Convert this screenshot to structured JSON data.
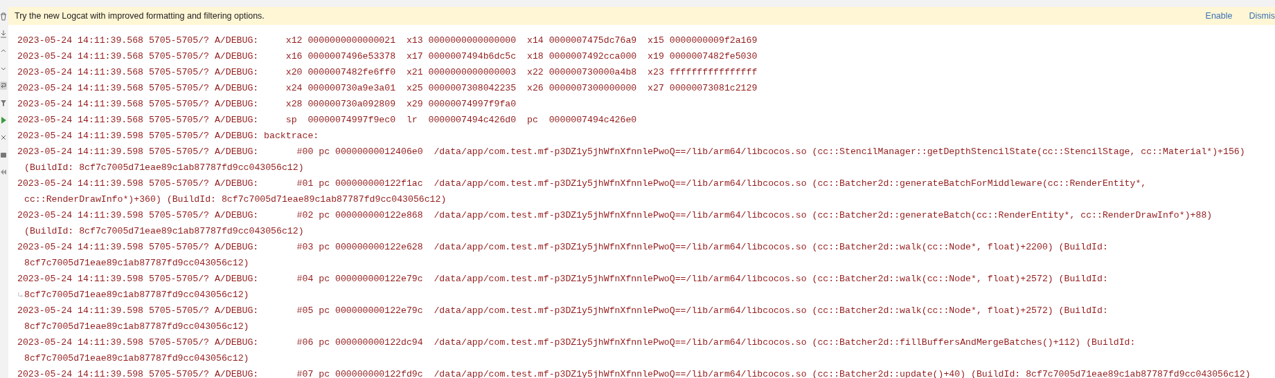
{
  "banner": {
    "message": "Try the new Logcat with improved formatting and filtering options.",
    "actions": [
      "Enable",
      "Dismis"
    ]
  },
  "toolbar": [
    {
      "kind": "trash",
      "selected": false
    },
    {
      "kind": "down",
      "selected": false
    },
    {
      "kind": "up",
      "selected": false
    },
    {
      "kind": "check",
      "selected": false
    },
    {
      "kind": "wrap",
      "selected": true
    },
    {
      "kind": "filter",
      "selected": false
    },
    {
      "kind": "play",
      "selected": false
    },
    {
      "kind": "close",
      "selected": false
    },
    {
      "kind": "camera",
      "selected": false
    },
    {
      "kind": "back",
      "selected": false
    }
  ],
  "log": [
    {
      "lines": [
        "2023-05-24 14:11:39.568 5705-5705/? A/DEBUG:     x12 0000000000000021  x13 0000000000000000  x14 0000007475dc76a9  x15 0000000009f2a169"
      ]
    },
    {
      "lines": [
        "2023-05-24 14:11:39.568 5705-5705/? A/DEBUG:     x16 0000007496e53378  x17 0000007494b6dc5c  x18 0000007492cca000  x19 0000007482fe5030"
      ]
    },
    {
      "lines": [
        "2023-05-24 14:11:39.568 5705-5705/? A/DEBUG:     x20 0000007482fe6ff0  x21 0000000000000003  x22 000000730000a4b8  x23 ffffffffffffffff"
      ]
    },
    {
      "lines": [
        "2023-05-24 14:11:39.568 5705-5705/? A/DEBUG:     x24 000000730a9e3a01  x25 0000007308042235  x26 0000007300000000  x27 00000073081c2129"
      ]
    },
    {
      "lines": [
        "2023-05-24 14:11:39.568 5705-5705/? A/DEBUG:     x28 000000730a092809  x29 00000074997f9fa0"
      ]
    },
    {
      "lines": [
        "2023-05-24 14:11:39.568 5705-5705/? A/DEBUG:     sp  00000074997f9ec0  lr  0000007494c426d0  pc  0000007494c426e0"
      ]
    },
    {
      "lines": [
        "2023-05-24 14:11:39.598 5705-5705/? A/DEBUG: backtrace:"
      ]
    },
    {
      "lines": [
        "2023-05-24 14:11:39.598 5705-5705/? A/DEBUG:       #00 pc 00000000012406e0  /data/app/com.test.mf-p3DZ1y5jhWfnXfnnlePwoQ==/lib/arm64/libcocos.so (cc::StencilManager::getDepthStencilState(cc::StencilStage, cc::Material*)+156)",
        "(BuildId: 8cf7c7005d71eae89c1ab87787fd9cc043056c12)"
      ]
    },
    {
      "lines": [
        "2023-05-24 14:11:39.598 5705-5705/? A/DEBUG:       #01 pc 000000000122f1ac  /data/app/com.test.mf-p3DZ1y5jhWfnXfnnlePwoQ==/lib/arm64/libcocos.so (cc::Batcher2d::generateBatchForMiddleware(cc::RenderEntity*,",
        "cc::RenderDrawInfo*)+360) (BuildId: 8cf7c7005d71eae89c1ab87787fd9cc043056c12)"
      ]
    },
    {
      "lines": [
        "2023-05-24 14:11:39.598 5705-5705/? A/DEBUG:       #02 pc 000000000122e868  /data/app/com.test.mf-p3DZ1y5jhWfnXfnnlePwoQ==/lib/arm64/libcocos.so (cc::Batcher2d::generateBatch(cc::RenderEntity*, cc::RenderDrawInfo*)+88)",
        "(BuildId: 8cf7c7005d71eae89c1ab87787fd9cc043056c12)"
      ]
    },
    {
      "lines": [
        "2023-05-24 14:11:39.598 5705-5705/? A/DEBUG:       #03 pc 000000000122e628  /data/app/com.test.mf-p3DZ1y5jhWfnXfnnlePwoQ==/lib/arm64/libcocos.so (cc::Batcher2d::walk(cc::Node*, float)+2200) (BuildId:",
        "8cf7c7005d71eae89c1ab87787fd9cc043056c12)"
      ]
    },
    {
      "lines": [
        "2023-05-24 14:11:39.598 5705-5705/? A/DEBUG:       #04 pc 000000000122e79c  /data/app/com.test.mf-p3DZ1y5jhWfnXfnnlePwoQ==/lib/arm64/libcocos.so (cc::Batcher2d::walk(cc::Node*, float)+2572) (BuildId:",
        "8cf7c7005d71eae89c1ab87787fd9cc043056c12)"
      ],
      "wrap_marker": true
    },
    {
      "lines": [
        "2023-05-24 14:11:39.598 5705-5705/? A/DEBUG:       #05 pc 000000000122e79c  /data/app/com.test.mf-p3DZ1y5jhWfnXfnnlePwoQ==/lib/arm64/libcocos.so (cc::Batcher2d::walk(cc::Node*, float)+2572) (BuildId:",
        "8cf7c7005d71eae89c1ab87787fd9cc043056c12)"
      ]
    },
    {
      "lines": [
        "2023-05-24 14:11:39.598 5705-5705/? A/DEBUG:       #06 pc 000000000122dc94  /data/app/com.test.mf-p3DZ1y5jhWfnXfnnlePwoQ==/lib/arm64/libcocos.so (cc::Batcher2d::fillBuffersAndMergeBatches()+112) (BuildId:",
        "8cf7c7005d71eae89c1ab87787fd9cc043056c12)"
      ]
    },
    {
      "lines": [
        "2023-05-24 14:11:39.598 5705-5705/? A/DEBUG:       #07 pc 000000000122fd9c  /data/app/com.test.mf-p3DZ1y5jhWfnXfnnlePwoQ==/lib/arm64/libcocos.so (cc::Batcher2d::update()+40) (BuildId: 8cf7c7005d71eae89c1ab87787fd9cc043056c12)"
      ]
    }
  ]
}
